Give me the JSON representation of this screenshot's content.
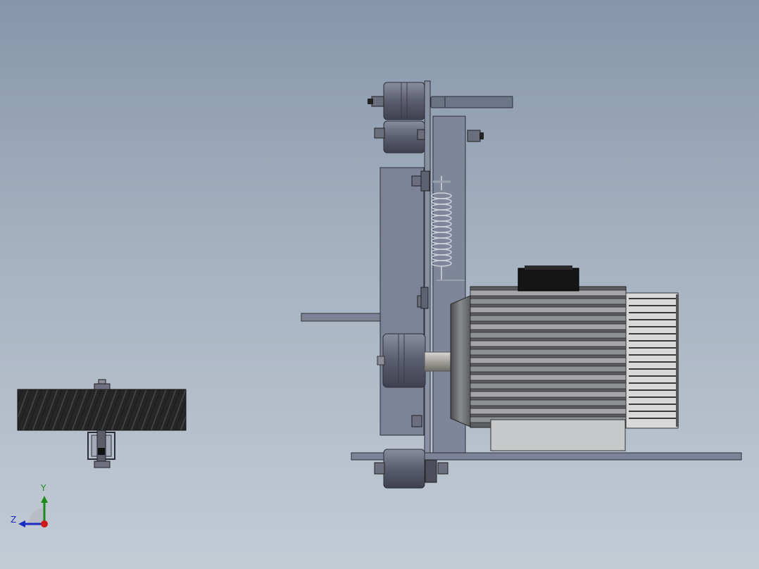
{
  "viewport": {
    "background_top": "#8696aa",
    "background_bottom": "#c3cbd5"
  },
  "triad": {
    "y_label": "Y",
    "z_label": "Z",
    "colors": {
      "y_axis": "#1c8a1c",
      "z_axis": "#1a2bbf",
      "x_axis": "#d01818"
    }
  },
  "model": {
    "parts": [
      "contact-wheel-side-view",
      "belt-grinder-frame",
      "tension-spring",
      "idler-wheels",
      "electric-motor",
      "motor-terminal-box",
      "motor-cooling-fan",
      "base-plate",
      "tool-rest-arm"
    ],
    "colors": {
      "frame_plate": "#7c8396",
      "wheel": "#5e6172",
      "motor_body": "#6d6f73",
      "motor_fins": "#9ea0a3",
      "wheel_rubber": "#2b2b2b"
    }
  }
}
